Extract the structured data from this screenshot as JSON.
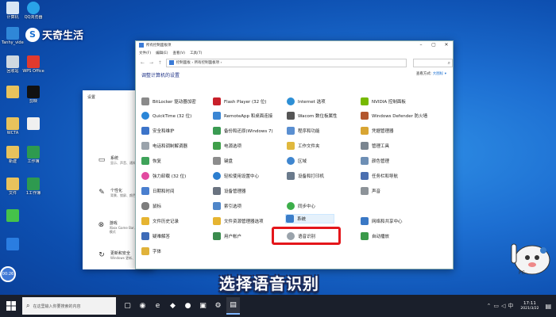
{
  "watermark": {
    "logo": "S",
    "text": "天奇生活"
  },
  "desktop_icons": [
    {
      "label": "计算机",
      "color": "#d8e6f5"
    },
    {
      "label": "QQ浏览器",
      "color": "#29a3e8"
    },
    {
      "label": "Tanhy_video 192.168.1…",
      "color": "#2f87d8"
    },
    {
      "label": "回收站",
      "color": "#cfd8e0"
    },
    {
      "label": "WPS Office",
      "color": "#e03a2e"
    },
    {
      "label": "",
      "color": "#e8c25c"
    },
    {
      "label": "剪映",
      "color": "#111111"
    },
    {
      "label": "",
      "color": "#e8c25c"
    },
    {
      "label": "",
      "color": "#f0f0f0"
    },
    {
      "label": "WCTA",
      "color": "#e8c25c"
    },
    {
      "label": "",
      "color": "#3aa55a"
    },
    {
      "label": "新建",
      "color": "#e8c25c"
    },
    {
      "label": "工作簿",
      "color": "#2e9a4f"
    },
    {
      "label": "文件",
      "color": "#e8c25c"
    },
    {
      "label": "1工作簿",
      "color": "#2e9a4f"
    },
    {
      "label": "",
      "color": "#45c24a"
    },
    {
      "label": "",
      "color": "#2a7de1"
    }
  ],
  "settings_window": {
    "title": "设置",
    "items": [
      {
        "icon": "▭",
        "title": "系统",
        "sub": "显示、声音、通知、电源"
      },
      {
        "icon": "✎",
        "title": "个性化",
        "sub": "背景、锁屏、颜色"
      },
      {
        "icon": "⊗",
        "title": "游戏",
        "sub": "Xbox Game Bar、捕获、游戏模式"
      },
      {
        "icon": "↻",
        "title": "更新和安全",
        "sub": "Windows 更新、恢复、备份"
      }
    ]
  },
  "control_panel": {
    "title": "所有控制面板项",
    "menu": [
      "文件(F)",
      "编辑(E)",
      "查看(V)",
      "工具(T)"
    ],
    "address": "控制面板 › 所有控制面板项 ›",
    "heading": "调整计算机的设置",
    "view_by_label": "查看方式:",
    "view_by_value": "大图标 ▾",
    "columns": [
      [
        {
          "label": "BitLocker 驱动器加密",
          "color": "#8a8a8a"
        },
        {
          "label": "QuickTime (32 位)",
          "color": "#2a86d8"
        },
        {
          "label": "安全和维护",
          "color": "#3c74c9"
        },
        {
          "label": "电话和调制解调器",
          "color": "#9aa3ab"
        },
        {
          "label": "恢复",
          "color": "#3fa35a"
        },
        {
          "label": "強力卸载 (32 位)",
          "color": "#e24aa0"
        },
        {
          "label": "日期和时间",
          "color": "#4a7fcf"
        },
        {
          "label": "鼠标",
          "color": "#7d7d7d"
        },
        {
          "label": "文件历史记录",
          "color": "#e6b431"
        },
        {
          "label": "疑难解答",
          "color": "#3d6bb8"
        },
        {
          "label": "字体",
          "color": "#e0b23a"
        }
      ],
      [
        {
          "label": "Flash Player (32 位)",
          "color": "#c8202a"
        },
        {
          "label": "RemoteApp 和桌面连接",
          "color": "#3b86d4"
        },
        {
          "label": "备份和还原(Windows 7)",
          "color": "#3a9b52"
        },
        {
          "label": "电源选项",
          "color": "#3f9f4a"
        },
        {
          "label": "键盘",
          "color": "#8c8c8c"
        },
        {
          "label": "轻松使用设置中心",
          "color": "#2c7ecf"
        },
        {
          "label": "设备管理器",
          "color": "#6a7380"
        },
        {
          "label": "索引选项",
          "color": "#4f86c9"
        },
        {
          "label": "文件资源管理器选项",
          "color": "#e6b431"
        },
        {
          "label": "用户帐户",
          "color": "#3a8b4d"
        }
      ],
      [
        {
          "label": "Internet 选项",
          "color": "#2d8fd5"
        },
        {
          "label": "Wacom 数位板属性",
          "color": "#555555"
        },
        {
          "label": "程序和功能",
          "color": "#5a8fd1"
        },
        {
          "label": "工作文件夹",
          "color": "#e0b83d"
        },
        {
          "label": "区域",
          "color": "#3f86cf"
        },
        {
          "label": "设备和打印机",
          "color": "#6a7a8c"
        },
        {
          "label": "同步中心",
          "color": "#3cae4a"
        },
        {
          "label": "系统",
          "color": "#3a7dc9"
        },
        {
          "label": "语音识别",
          "color": "#9aa3ab"
        }
      ],
      [
        {
          "label": "NVIDIA 控制面板",
          "color": "#76b900"
        },
        {
          "label": "Windows Defender 防火墙",
          "color": "#b2562d"
        },
        {
          "label": "凭据管理器",
          "color": "#d8a533"
        },
        {
          "label": "管理工具",
          "color": "#7a8590"
        },
        {
          "label": "颜色管理",
          "color": "#6e8fb5"
        },
        {
          "label": "任务栏和导航",
          "color": "#4a6fb0"
        },
        {
          "label": "声音",
          "color": "#8d9399"
        },
        {
          "label": "网络和共享中心",
          "color": "#3a78c5"
        },
        {
          "label": "自动播放",
          "color": "#3a9a4a"
        }
      ]
    ]
  },
  "caption": "选择语音识别",
  "taskbar": {
    "search_placeholder": "在这里输入你要搜索的内容",
    "apps": [
      "▢",
      "◉",
      "e",
      "◆",
      "●",
      "▣",
      "⚙",
      "▤"
    ],
    "time": "17:11",
    "date": "2021/3/22"
  },
  "mascot_label": "PC"
}
